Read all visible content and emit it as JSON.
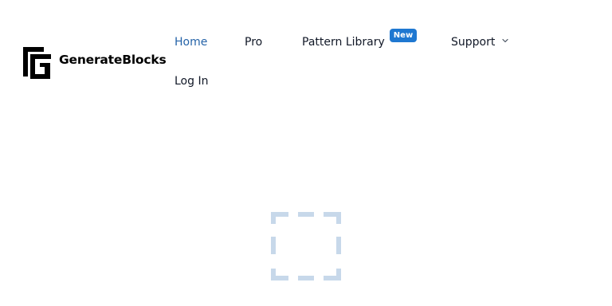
{
  "brand": {
    "name": "GenerateBlocks"
  },
  "nav": {
    "home": "Home",
    "pro": "Pro",
    "pattern_library": "Pattern Library",
    "new_badge": "New",
    "support": "Support",
    "login": "Log In"
  },
  "colors": {
    "active": "#2563a8",
    "badge": "#1f78d1",
    "placeholder": "#c7d8ea"
  },
  "icons": {
    "logo": "generateblocks-logo-icon",
    "support_chevron": "chevron-down-icon",
    "loading": "loading-placeholder-icon"
  }
}
